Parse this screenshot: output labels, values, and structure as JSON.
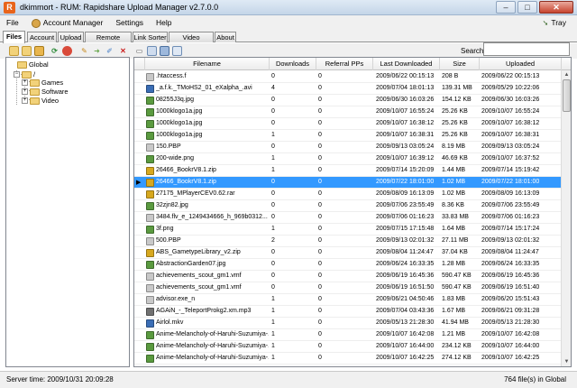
{
  "window": {
    "title": "dkimmort - RUM: Rapidshare Upload Manager v2.7.0.0",
    "app_icon_letter": "R",
    "minimize": "–",
    "maximize": "□",
    "close": "✕"
  },
  "menu": {
    "file": "File",
    "account_manager": "Account Manager",
    "settings": "Settings",
    "help": "Help",
    "tray": "Tray"
  },
  "tabs": [
    "Files",
    "Account",
    "Upload",
    "Remote Uploads",
    "Link Sorter",
    "Video Streamer",
    "About"
  ],
  "toolbar": {
    "search_label": "Search:",
    "search_value": "",
    "icons": [
      "new-folder-icon",
      "open-folder-icon",
      "folder-icon",
      "refresh-icon",
      "stop-icon",
      "rename-icon",
      "move-icon",
      "edit-icon",
      "delete-icon",
      "print-icon",
      "copy-icon",
      "save-icon",
      "export-icon"
    ]
  },
  "tree": {
    "global": "Global",
    "root": "/",
    "games": "Games",
    "software": "Software",
    "video": "Video"
  },
  "columns": [
    "Filename",
    "Downloads",
    "Referral PPs",
    "Last Downloaded",
    "Size",
    "Uploaded"
  ],
  "colors": {
    "selection": "#3399ff",
    "image_file": "#5a9a3f",
    "archive_file": "#d7a81e",
    "generic_file": "#c8c8c8",
    "audio_file": "#707070",
    "video_file": "#3a6db5"
  },
  "rows": [
    {
      "name": ".htaccess.f",
      "downloads": "0",
      "ref": "0",
      "last": "2009/06/22 00:15:13",
      "size": "208 B",
      "uploaded": "2009/06/22 00:15:13",
      "icon": "generic"
    },
    {
      "name": "_a.f.k._TMoHS2_01_eXalpha_.avi",
      "downloads": "4",
      "ref": "0",
      "last": "2009/07/04 18:01:13",
      "size": "139.31 MB",
      "uploaded": "2009/05/29 10:22:06",
      "icon": "video"
    },
    {
      "name": "08255J3q.jpg",
      "downloads": "0",
      "ref": "0",
      "last": "2009/06/30 16:03:26",
      "size": "154.12 KB",
      "uploaded": "2009/06/30 16:03:26",
      "icon": "image"
    },
    {
      "name": "1000klogo1a.jpg",
      "downloads": "0",
      "ref": "0",
      "last": "2009/10/07 16:55:24",
      "size": "25.26 KB",
      "uploaded": "2009/10/07 16:55:24",
      "icon": "image"
    },
    {
      "name": "1000klogo1a.jpg",
      "downloads": "0",
      "ref": "0",
      "last": "2009/10/07 16:38:12",
      "size": "25.26 KB",
      "uploaded": "2009/10/07 16:38:12",
      "icon": "image"
    },
    {
      "name": "1000klogo1a.jpg",
      "downloads": "1",
      "ref": "0",
      "last": "2009/10/07 16:38:31",
      "size": "25.26 KB",
      "uploaded": "2009/10/07 16:38:31",
      "icon": "image"
    },
    {
      "name": "150.PBP",
      "downloads": "0",
      "ref": "0",
      "last": "2009/09/13 03:05:24",
      "size": "8.19 MB",
      "uploaded": "2009/09/13 03:05:24",
      "icon": "generic"
    },
    {
      "name": "200-wide.png",
      "downloads": "1",
      "ref": "0",
      "last": "2009/10/07 16:39:12",
      "size": "46.69 KB",
      "uploaded": "2009/10/07 16:37:52",
      "icon": "image"
    },
    {
      "name": "26466_BookrV8.1.zip",
      "downloads": "1",
      "ref": "0",
      "last": "2009/07/14 15:20:09",
      "size": "1.44 MB",
      "uploaded": "2009/07/14 15:19:42",
      "icon": "archive"
    },
    {
      "name": "26466_BookrV8.1.zip",
      "downloads": "0",
      "ref": "0",
      "last": "2009/07/22 18:01:00",
      "size": "1.02 MB",
      "uploaded": "2009/07/22 18:01:00",
      "icon": "archive",
      "selected": true
    },
    {
      "name": "27175_MPlayerCEV0.62.rar",
      "downloads": "0",
      "ref": "0",
      "last": "2009/08/09 16:13:09",
      "size": "1.02 MB",
      "uploaded": "2009/08/09 16:13:09",
      "icon": "archive"
    },
    {
      "name": "32zjn82.jpg",
      "downloads": "0",
      "ref": "0",
      "last": "2009/07/06 23:55:49",
      "size": "8.36 KB",
      "uploaded": "2009/07/06 23:55:49",
      "icon": "image"
    },
    {
      "name": "3484.flv_e_1249434666_h_969b0312...",
      "downloads": "0",
      "ref": "0",
      "last": "2009/07/06 01:16:23",
      "size": "33.83 MB",
      "uploaded": "2009/07/06 01:16:23",
      "icon": "generic"
    },
    {
      "name": "3f.png",
      "downloads": "1",
      "ref": "0",
      "last": "2009/07/15 17:15:48",
      "size": "1.64 MB",
      "uploaded": "2009/07/14 15:17:24",
      "icon": "image"
    },
    {
      "name": "500.PBP",
      "downloads": "2",
      "ref": "0",
      "last": "2009/09/13 02:01:32",
      "size": "27.11 MB",
      "uploaded": "2009/09/13 02:01:32",
      "icon": "generic"
    },
    {
      "name": "ABS_GametypeLibrary_v2.zip",
      "downloads": "0",
      "ref": "0",
      "last": "2009/08/04 11:24:47",
      "size": "37.04 KB",
      "uploaded": "2009/08/04 11:24:47",
      "icon": "archive"
    },
    {
      "name": "AbstractionGarden07.jpg",
      "downloads": "0",
      "ref": "0",
      "last": "2009/06/24 16:33:35",
      "size": "1.28 MB",
      "uploaded": "2009/06/24 16:33:35",
      "icon": "image"
    },
    {
      "name": "achievements_scout_gm1.vmf",
      "downloads": "0",
      "ref": "0",
      "last": "2009/06/19 16:45:36",
      "size": "590.47 KB",
      "uploaded": "2009/06/19 16:45:36",
      "icon": "generic"
    },
    {
      "name": "achievements_scout_gm1.vmf",
      "downloads": "0",
      "ref": "0",
      "last": "2009/06/19 16:51:50",
      "size": "590.47 KB",
      "uploaded": "2009/06/19 16:51:40",
      "icon": "generic"
    },
    {
      "name": "advisor.exe_n",
      "downloads": "1",
      "ref": "0",
      "last": "2009/06/21 04:50:46",
      "size": "1.83 MB",
      "uploaded": "2009/06/20 15:51:43",
      "icon": "generic"
    },
    {
      "name": "AGAiN_-_TeleportProkg2.xm.mp3",
      "downloads": "1",
      "ref": "0",
      "last": "2009/07/04 03:43:36",
      "size": "1.67 MB",
      "uploaded": "2009/06/21 09:31:28",
      "icon": "audio"
    },
    {
      "name": "Airlol.mkv",
      "downloads": "1",
      "ref": "0",
      "last": "2009/05/13 21:28:30",
      "size": "41.94 MB",
      "uploaded": "2009/05/13 21:28:30",
      "icon": "video"
    },
    {
      "name": "Anime-Melancholy-of-Haruhi-Suzumiya-...",
      "downloads": "1",
      "ref": "0",
      "last": "2009/10/07 16:42:08",
      "size": "1.21 MB",
      "uploaded": "2009/10/07 16:42:08",
      "icon": "image"
    },
    {
      "name": "Anime-Melancholy-of-Haruhi-Suzumiya-...",
      "downloads": "1",
      "ref": "0",
      "last": "2009/10/07 16:44:00",
      "size": "234.12 KB",
      "uploaded": "2009/10/07 16:44:00",
      "icon": "image"
    },
    {
      "name": "Anime-Melancholy-of-Haruhi-Suzumiya-...",
      "downloads": "1",
      "ref": "0",
      "last": "2009/10/07 16:42:25",
      "size": "274.12 KB",
      "uploaded": "2009/10/07 16:42:25",
      "icon": "image"
    }
  ],
  "status": {
    "server_time": "Server time: 2009/10/31 20:09:28",
    "file_count": "764 file(s) in Global"
  }
}
